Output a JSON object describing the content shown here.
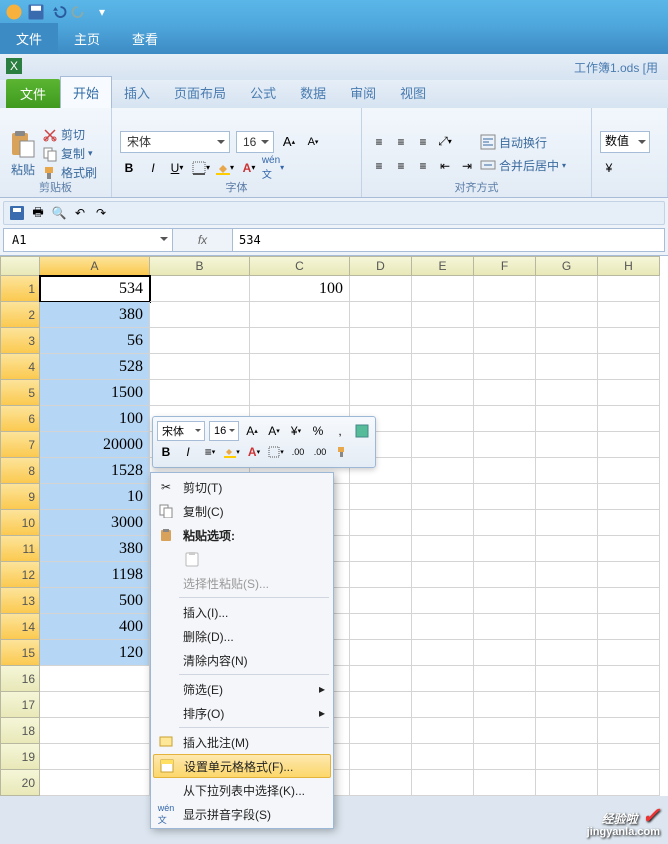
{
  "outer_tabs": {
    "file": "文件",
    "home": "主页",
    "view": "查看"
  },
  "doc_title": "工作簿1.ods [用",
  "ribbon_tabs": {
    "file": "文件",
    "start": "开始",
    "insert": "插入",
    "layout": "页面布局",
    "formula": "公式",
    "data": "数据",
    "review": "审阅",
    "view": "视图"
  },
  "clipboard": {
    "paste": "粘贴",
    "cut": "剪切",
    "copy": "复制",
    "brush": "格式刷",
    "group": "剪贴板"
  },
  "font": {
    "name": "宋体",
    "size": "16",
    "group": "字体"
  },
  "align": {
    "wrap": "自动换行",
    "merge": "合并后居中",
    "group": "对齐方式"
  },
  "number": {
    "kind": "数值"
  },
  "namebox": "A1",
  "fx": "fx",
  "formula_value": "534",
  "columns": [
    "A",
    "B",
    "C",
    "D",
    "E",
    "F",
    "G",
    "H"
  ],
  "rows_count": 20,
  "cells_A": [
    "534",
    "380",
    "56",
    "528",
    "1500",
    "100",
    "20000",
    "1528",
    "10",
    "3000",
    "380",
    "1198",
    "500",
    "400",
    "120"
  ],
  "cell_C1": "100",
  "mini": {
    "font": "宋体",
    "size": "16"
  },
  "ctx": {
    "cut": "剪切(T)",
    "copy": "复制(C)",
    "paste_header": "粘贴选项:",
    "paste_special": "选择性粘贴(S)...",
    "insert": "插入(I)...",
    "delete": "删除(D)...",
    "clear": "清除内容(N)",
    "filter": "筛选(E)",
    "sort": "排序(O)",
    "comment": "插入批注(M)",
    "format": "设置单元格格式(F)...",
    "pick": "从下拉列表中选择(K)...",
    "pinyin": "显示拼音字段(S)"
  },
  "watermark": {
    "main": "经验啦",
    "sub": "jingyanla.com"
  }
}
